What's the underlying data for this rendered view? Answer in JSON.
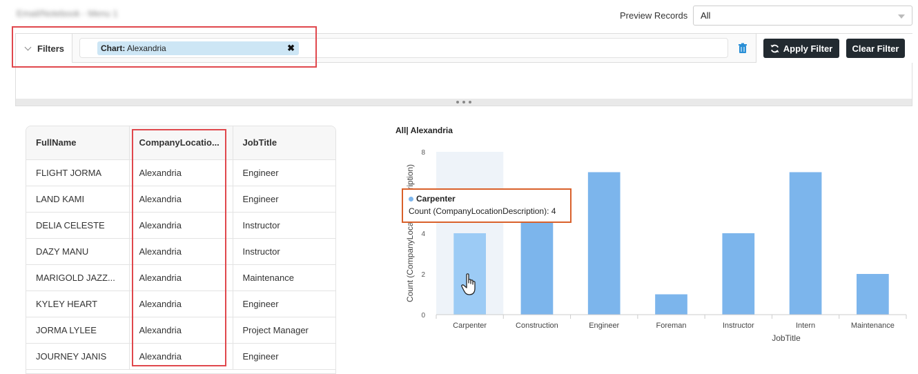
{
  "header": {
    "blurred_title": "Email/Notebook - Menu 1",
    "preview_label": "Preview Records",
    "preview_value": "All"
  },
  "filters": {
    "toggle_label": "Filters",
    "chip_key": "Chart:",
    "chip_value": "Alexandria",
    "chip_remove": "✖",
    "apply_label": "Apply Filter",
    "clear_label": "Clear Filter"
  },
  "grid": {
    "columns": [
      "FullName",
      "CompanyLocatio...",
      "JobTitle"
    ],
    "rows": [
      [
        "FLIGHT JORMA",
        "Alexandria",
        "Engineer"
      ],
      [
        "LAND KAMI",
        "Alexandria",
        "Engineer"
      ],
      [
        "DELIA CELESTE",
        "Alexandria",
        "Instructor"
      ],
      [
        "DAZY MANU",
        "Alexandria",
        "Instructor"
      ],
      [
        "MARIGOLD JAZZ...",
        "Alexandria",
        "Maintenance"
      ],
      [
        "KYLEY HEART",
        "Alexandria",
        "Engineer"
      ],
      [
        "JORMA LYLEE",
        "Alexandria",
        "Project Manager"
      ],
      [
        "JOURNEY JANIS",
        "Alexandria",
        "Engineer"
      ]
    ]
  },
  "chart_data": {
    "type": "bar",
    "title": "All| Alexandria",
    "categories": [
      "Carpenter",
      "Construction",
      "Engineer",
      "Foreman",
      "Instructor",
      "Intern",
      "Maintenance"
    ],
    "values": [
      4,
      5,
      7,
      1,
      4,
      7,
      2
    ],
    "xlabel": "JobTitle",
    "ylabel": "Count (CompanyLocationDescription)",
    "ylim": [
      0,
      8
    ],
    "yticks": [
      0,
      2,
      4,
      6,
      8
    ],
    "grid": false,
    "highlighted_category": "Carpenter",
    "bar_color": "#7cb5ec",
    "highlight_color": "#9ccbf5"
  },
  "tooltip": {
    "title": "Carpenter",
    "line": "Count (CompanyLocationDescription): 4"
  },
  "colors": {
    "accent_red": "#e0474c",
    "tooltip_border": "#d9602a",
    "button_dark": "#222a30",
    "chip_bg": "#cde6f5"
  }
}
